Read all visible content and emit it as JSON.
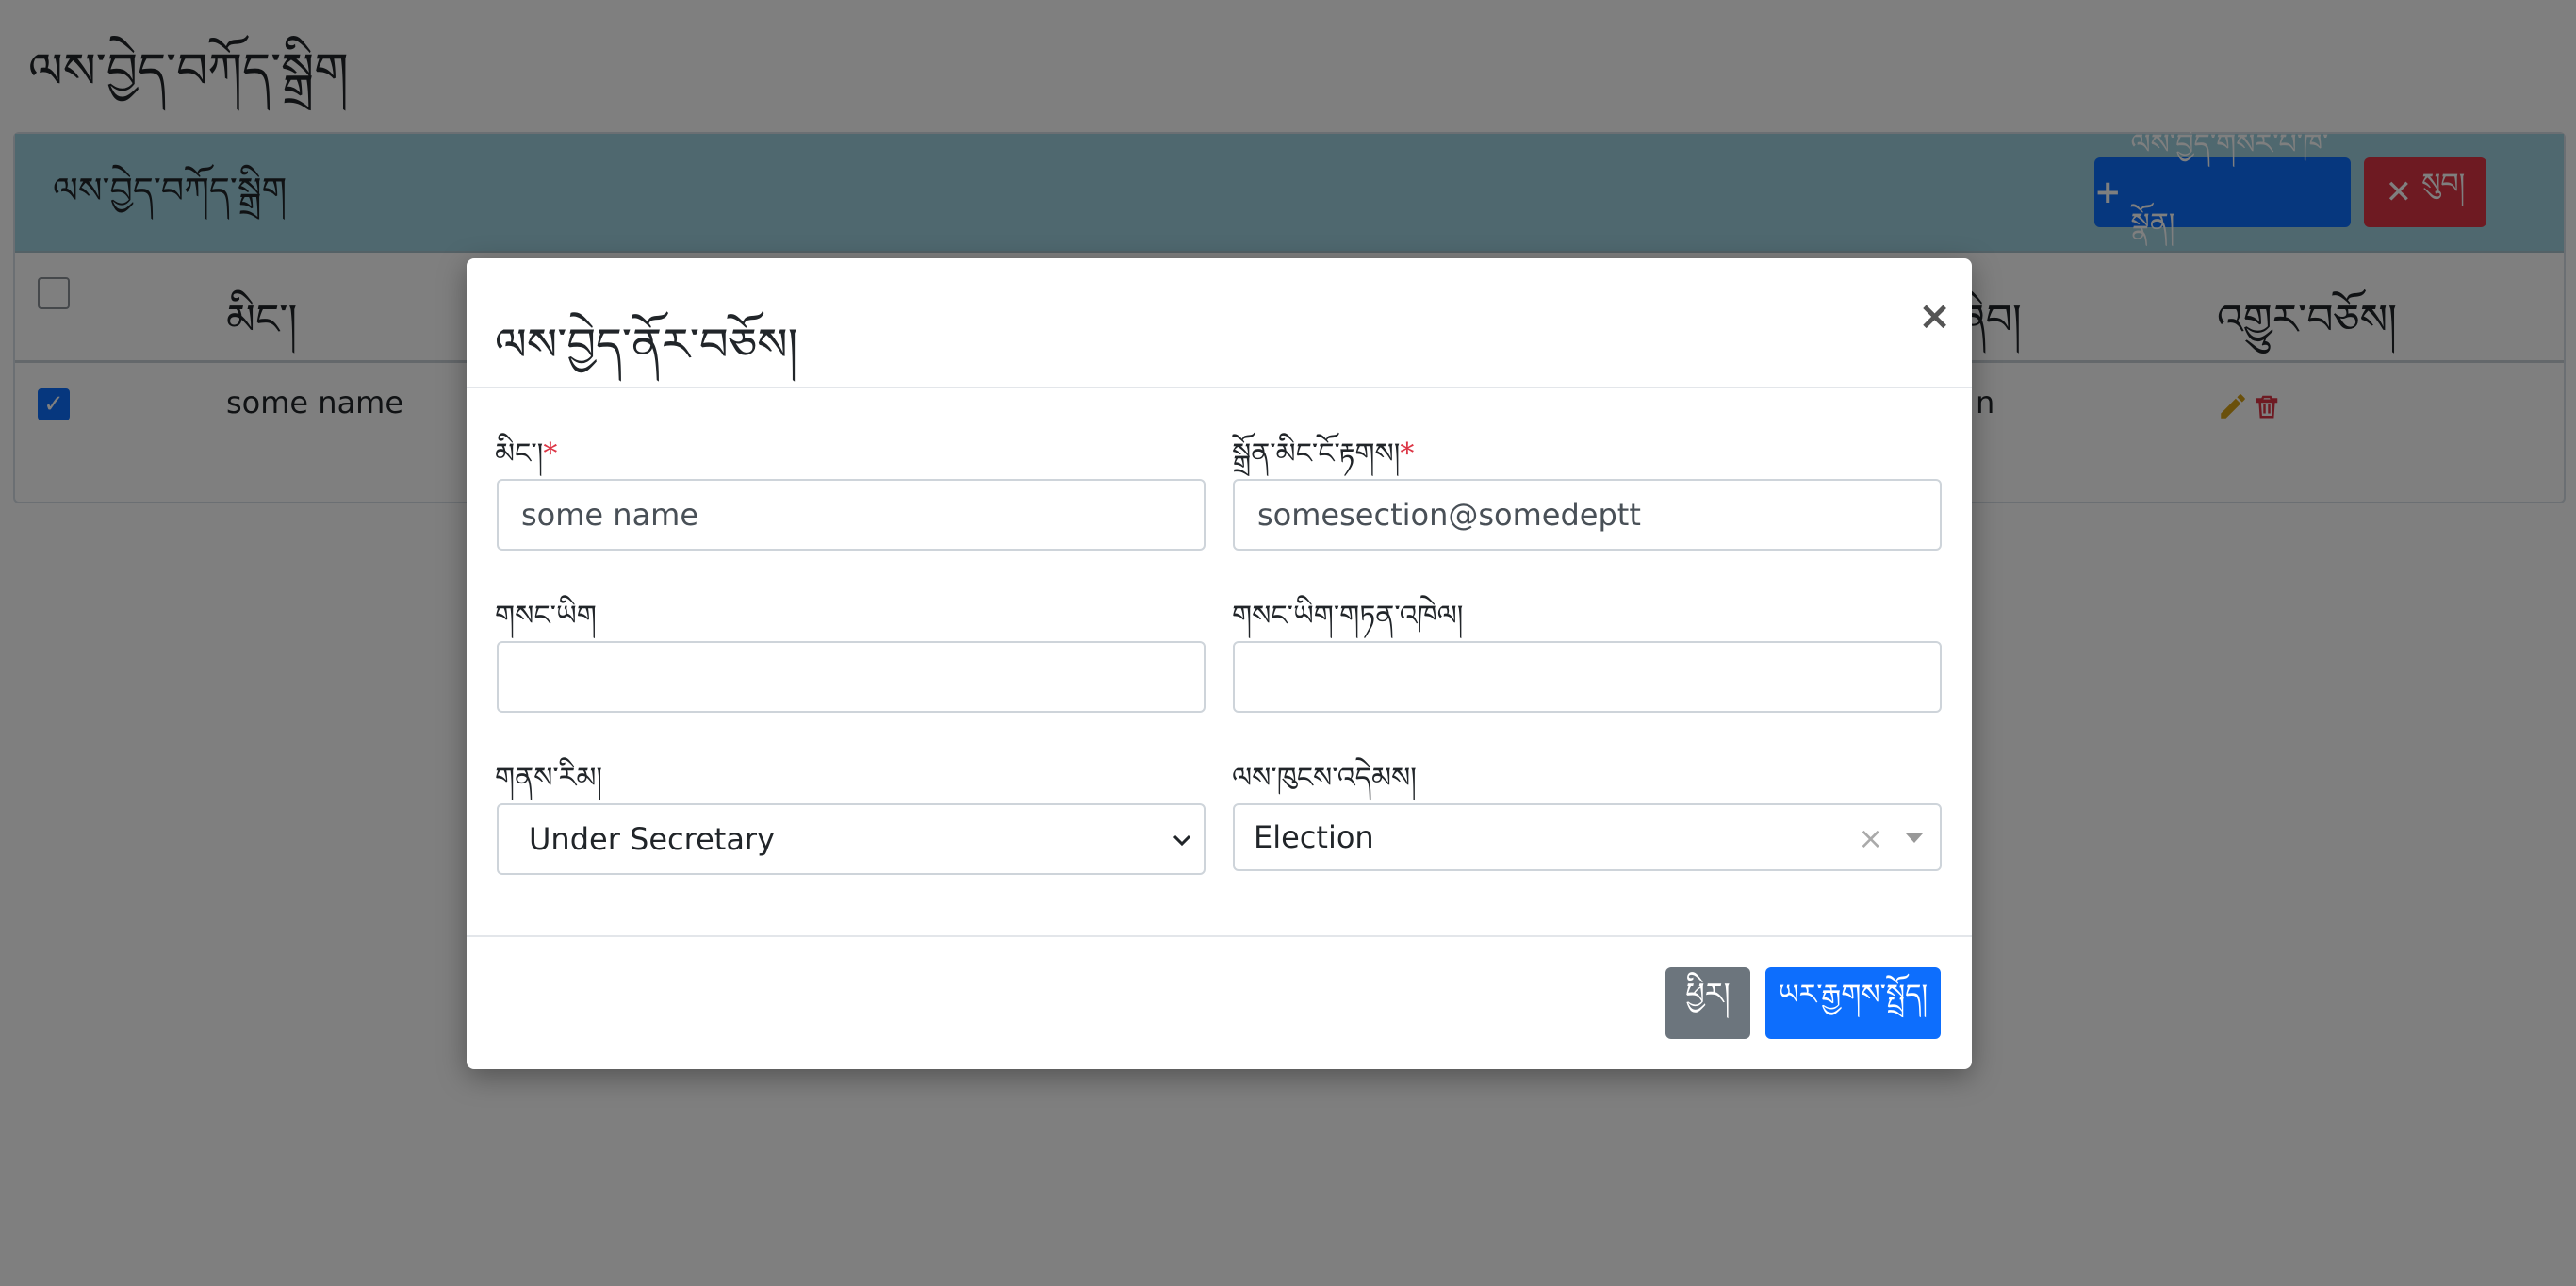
{
  "page": {
    "title": "ལས་བྱེད་བཀོད་སྒྲིག"
  },
  "card": {
    "title": "ལས་བྱེད་བཀོད་སྒྲིག",
    "add_button": "ལས་བྱེད་གསར་པ་ཁ་སྣོན།",
    "delete_button": "སུབ།"
  },
  "table": {
    "headers": [
      "མིང་།",
      "",
      "",
      "",
      "",
      "ཞིབ།",
      "འགྱུར་བཅོས།"
    ],
    "rows": [
      {
        "checked": true,
        "name": "some name",
        "partial": "n"
      }
    ]
  },
  "modal": {
    "title": "ལས་བྱེད་ནོར་བཅོས།",
    "close": "×",
    "fields": {
      "name_label": "མིང་།",
      "name_value": "some name",
      "email_label": "སྒྲོན་མིང་ངོ་རྟགས།",
      "email_value": "somesection@somedeptt",
      "phone_label": "གསང་ཡིག",
      "phone_value": "",
      "phone_confirm_label": "གསང་ཡིག་གཏན་འཁེལ།",
      "phone_confirm_value": "",
      "post_label": "གནས་རིམ།",
      "post_value": "Under Secretary",
      "section_label": "ལས་ཁུངས་འདེམས།",
      "section_value": "Election"
    },
    "required_mark": "*",
    "cancel_button": "ཕྱིར།",
    "save_button": "ཡར་རྒྱགས་སྤྲོད།"
  },
  "colors": {
    "primary": "#0d6efd",
    "danger": "#dc3545",
    "secondary": "#6c757d",
    "header_bg": "#9fd0de",
    "edit_icon": "#d4a017"
  },
  "icons": [
    "plus-icon",
    "x-icon",
    "pencil-icon",
    "trash-icon",
    "close-icon",
    "chevron-down-icon",
    "clear-icon",
    "caret-down-icon"
  ]
}
